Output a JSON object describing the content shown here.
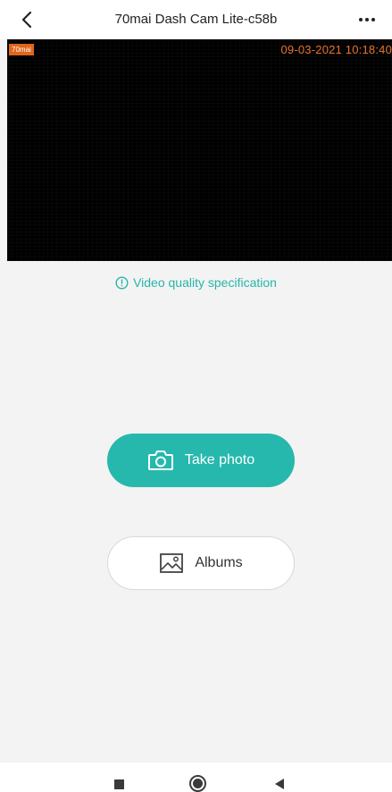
{
  "header": {
    "title": "70mai Dash Cam Lite-c58b",
    "back_icon": "chevron-left-icon",
    "more_icon": "more-horizontal-icon"
  },
  "video": {
    "logo_text": "70mai",
    "timestamp": "09-03-2021 10:18:40",
    "background_color": "#000000",
    "overlay_color": "#e8742d"
  },
  "quality_link": {
    "icon": "info-circle-icon",
    "label": "Video quality specification",
    "color": "#27b5aa"
  },
  "actions": {
    "take_photo": {
      "label": "Take photo",
      "icon": "camera-icon",
      "color": "#27b8ad"
    },
    "albums": {
      "label": "Albums",
      "icon": "image-icon"
    }
  },
  "navbar": {
    "recents_icon": "square-icon",
    "home_icon": "circle-home-icon",
    "back_icon": "triangle-back-icon"
  }
}
